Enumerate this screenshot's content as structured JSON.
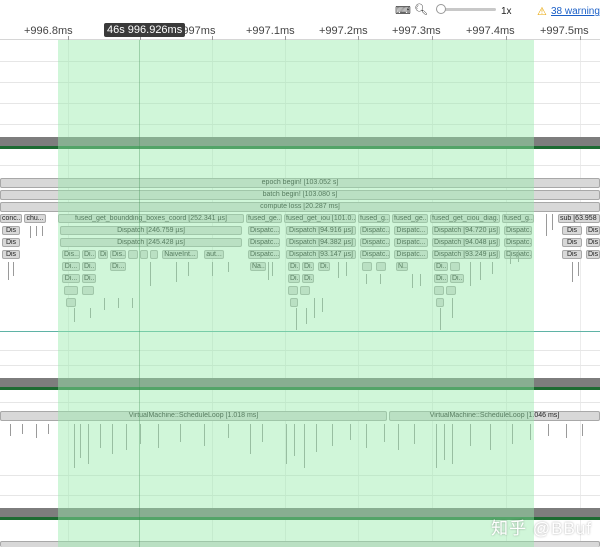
{
  "toolbar": {
    "keyboard_icon": "keyboard-icon",
    "zoom_icon": "zoom-out-icon",
    "zoom_level": "1x",
    "warning_icon": "warning-icon",
    "warning_text": "38 warning"
  },
  "ruler": {
    "ticks": [
      "+996.8ms",
      "+997ms",
      "+997.1ms",
      "+997.2ms",
      "+997.3ms",
      "+997.4ms",
      "+997.5ms"
    ],
    "hover_time": "46s 996.926ms"
  },
  "track1": {
    "epoch": "epoch begin! [103.052 s]",
    "batch": "batch begin! [103.080 s]",
    "compute_loss": "compute loss [20.287 ms]",
    "row4": [
      "conc...",
      "chu...",
      "fused_get_boundding_boxes_coord [252.341 µs]",
      "fused_ge...",
      "fused_get_iou [101.0...",
      "fused_g...",
      "fused_ge...",
      "fused_get_ciou_diag...",
      "fused_g...",
      "sub [63.958"
    ],
    "row5": [
      "Dis",
      "Dispatch [246.759 µs]",
      "Dispatc...",
      "Dispatch [94.916 µs]",
      "Dispatc...",
      "Dispatc...",
      "Dispatch [94.720 µs]",
      "Dispatc...",
      "Dis",
      "Dis"
    ],
    "row6": [
      "Dis",
      "Dispatch [245.428 µs]",
      "Dispatc...",
      "Dispatch [94.382 µs]",
      "Dispatc...",
      "Dispatc...",
      "Dispatch [94.048 µs]",
      "Dispatc...",
      "Dis",
      "Dis"
    ],
    "row7": [
      "Dis",
      "Dis...",
      "Di...",
      "Di...",
      "Dis...",
      "NaiveInt...",
      "aut...",
      "Dispatc...",
      "Dispatch [93.147 µs]",
      "Dispatc...",
      "Dispatc...",
      "Dispatch [93.249 µs]",
      "Dispatc...",
      "Dis",
      "Dis"
    ],
    "row8": [
      "Di...",
      "Di...",
      "Di...",
      "Na...",
      "Di...",
      "Di...",
      "Di...",
      "N...",
      "Di..."
    ],
    "row9": [
      "Di...",
      "Di...",
      "Di...",
      "Di...",
      "Di...",
      "Di..."
    ]
  },
  "track2": {
    "loop_left": "VirtualMachine::ScheduleLoop [1.018 ms]",
    "loop_right": "VirtualMachine::ScheduleLoop [1.046 ms]"
  },
  "watermark": "知乎 @BBuf"
}
